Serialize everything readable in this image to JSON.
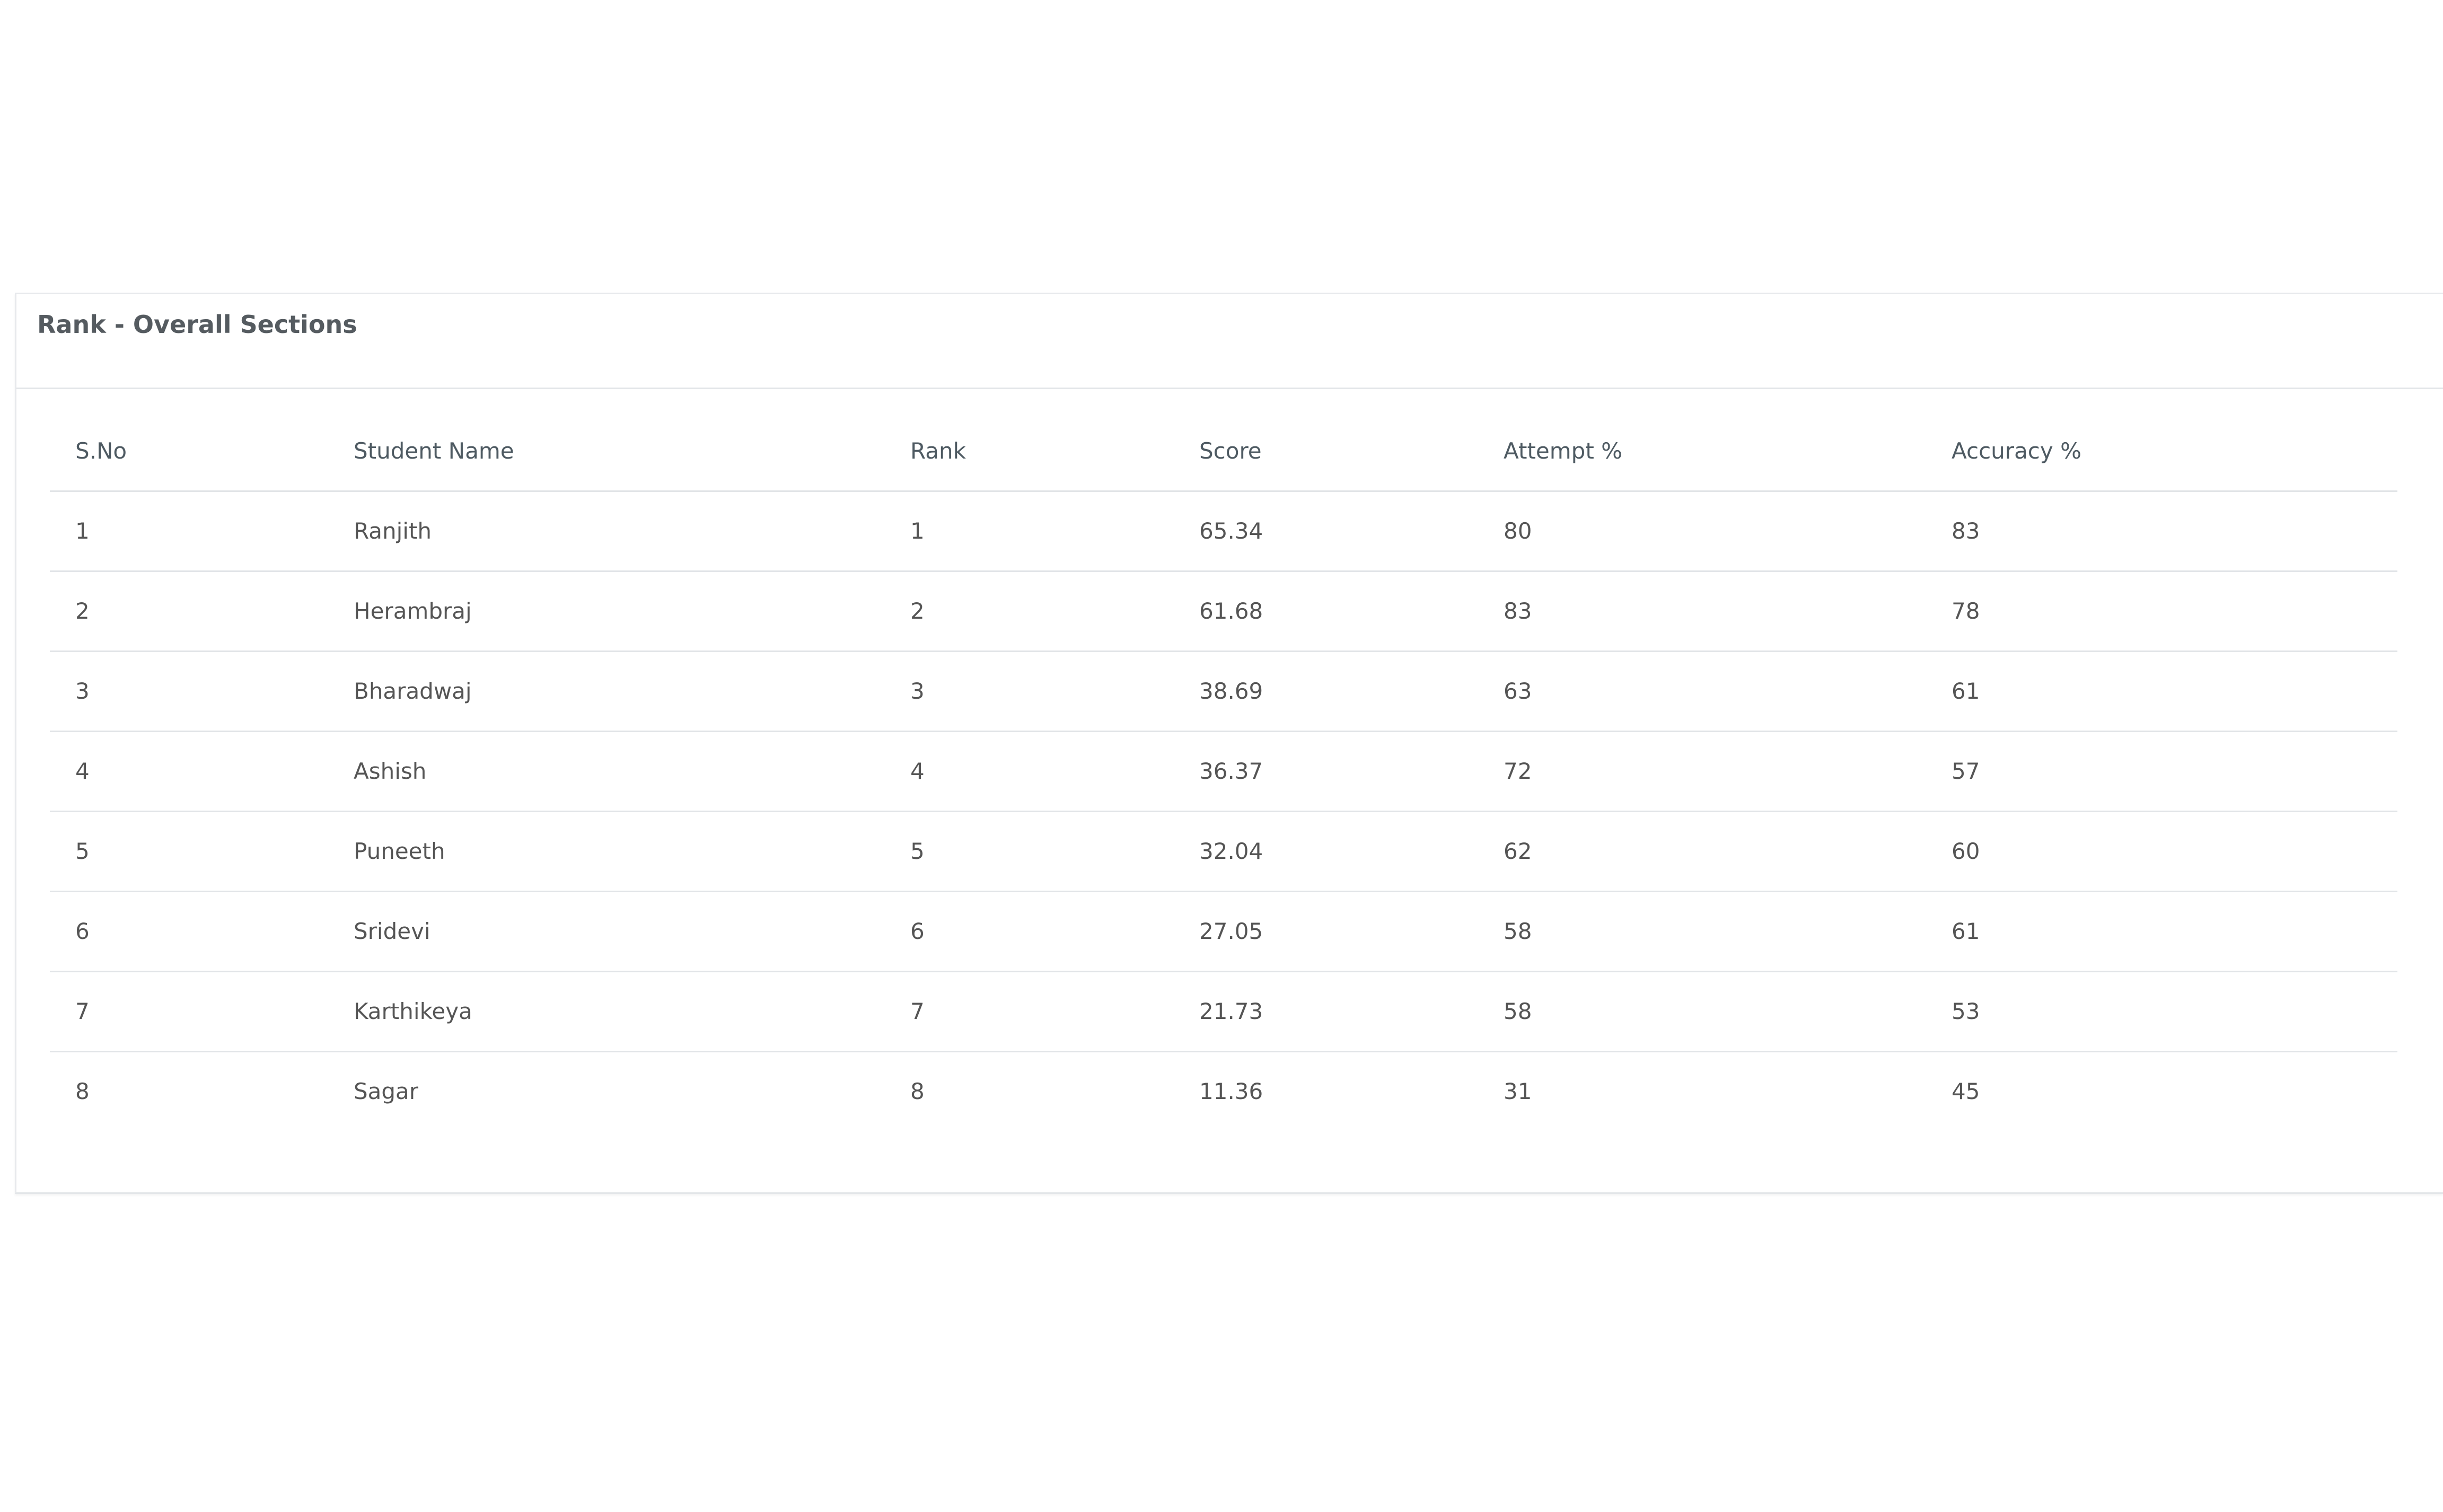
{
  "panel": {
    "title": "Rank - Overall Sections"
  },
  "table": {
    "headers": {
      "sno": "S.No",
      "name": "Student Name",
      "rank": "Rank",
      "score": "Score",
      "attempt": "Attempt %",
      "accuracy": "Accuracy %"
    },
    "rows": [
      {
        "sno": "1",
        "name": "Ranjith",
        "rank": "1",
        "score": "65.34",
        "attempt": "80",
        "accuracy": "83"
      },
      {
        "sno": "2",
        "name": "Herambraj",
        "rank": "2",
        "score": "61.68",
        "attempt": "83",
        "accuracy": "78"
      },
      {
        "sno": "3",
        "name": "Bharadwaj",
        "rank": "3",
        "score": "38.69",
        "attempt": "63",
        "accuracy": "61"
      },
      {
        "sno": "4",
        "name": "Ashish",
        "rank": "4",
        "score": "36.37",
        "attempt": "72",
        "accuracy": "57"
      },
      {
        "sno": "5",
        "name": "Puneeth",
        "rank": "5",
        "score": "32.04",
        "attempt": "62",
        "accuracy": "60"
      },
      {
        "sno": "6",
        "name": "Sridevi",
        "rank": "6",
        "score": "27.05",
        "attempt": "58",
        "accuracy": "61"
      },
      {
        "sno": "7",
        "name": "Karthikeya",
        "rank": "7",
        "score": "21.73",
        "attempt": "58",
        "accuracy": "53"
      },
      {
        "sno": "8",
        "name": "Sagar",
        "rank": "8",
        "score": "11.36",
        "attempt": "31",
        "accuracy": "45"
      }
    ]
  }
}
